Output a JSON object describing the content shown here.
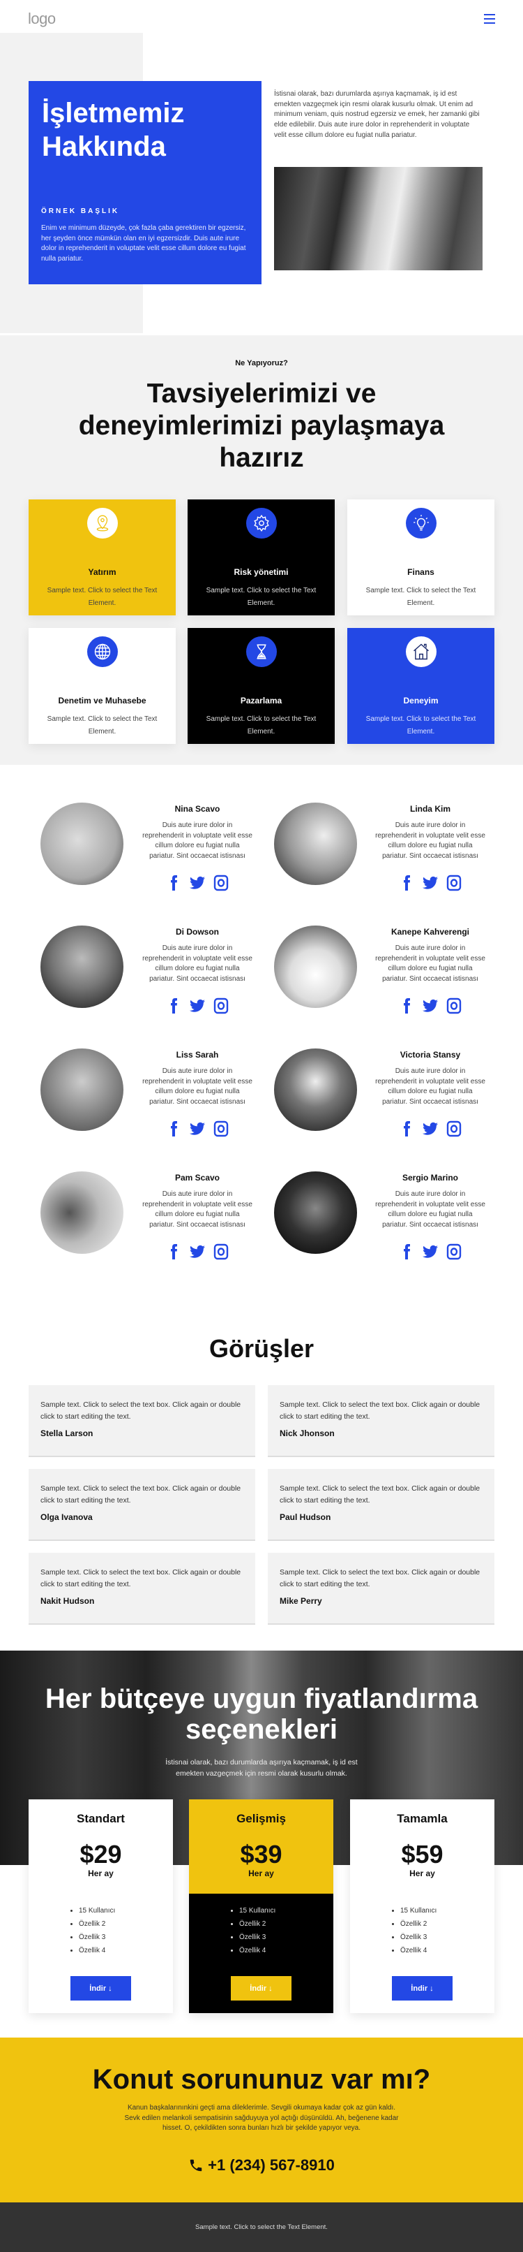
{
  "colors": {
    "accent_blue": "#2348e5",
    "accent_yellow": "#f0c30f",
    "black": "#000000",
    "light_gray": "#f2f2f2",
    "footer": "#333333"
  },
  "header": {
    "logo": "logo",
    "menu_icon": "hamburger-icon"
  },
  "about": {
    "title_line1": "İşletmemiz",
    "title_line2": "Hakkında",
    "eyebrow": "ÖRNEK BAŞLIK",
    "blue_text": "Enim ve minimum düzeyde, çok fazla çaba gerektiren bir egzersiz, her şeyden önce mümkün olan en iyi egzersizdir. Duis aute irure dolor in reprehenderit in voluptate velit esse cillum dolore eu fugiat nulla pariatur.",
    "right_text": "İstisnai olarak, bazı durumlarda aşırıya kaçmamak, iş id est emekten vazgeçmek için resmi olarak kusurlu olmak. Ut enim ad minimum veniam, quis nostrud egzersiz ve emek, her zamanki gibi elde edilebilir. Duis aute irure dolor in reprehenderit in voluptate velit esse cillum dolore eu fugiat nulla pariatur."
  },
  "services": {
    "eyebrow": "Ne Yapıyoruz?",
    "heading_line1": "Tavsiyelerimizi ve",
    "heading_line2": "deneyimlerimizi paylaşmaya",
    "heading_line3": "hazırız",
    "items": [
      {
        "title": "Yatırım",
        "text": "Sample text. Click to select the Text Element.",
        "icon": "location-pin-icon",
        "theme": "yellow"
      },
      {
        "title": "Risk yönetimi",
        "text": "Sample text. Click to select the Text Element.",
        "icon": "gear-icon",
        "theme": "black"
      },
      {
        "title": "Finans",
        "text": "Sample text. Click to select the Text Element.",
        "icon": "lightbulb-icon",
        "theme": "white"
      },
      {
        "title": "Denetim ve Muhasebe",
        "text": "Sample text. Click to select the Text Element.",
        "icon": "globe-icon",
        "theme": "white"
      },
      {
        "title": "Pazarlama",
        "text": "Sample text. Click to select the Text Element.",
        "icon": "hourglass-icon",
        "theme": "black"
      },
      {
        "title": "Deneyim",
        "text": "Sample text. Click to select the Text Element.",
        "icon": "house-icon",
        "theme": "blue"
      }
    ]
  },
  "team": {
    "bio": "Duis aute irure dolor in reprehenderit in voluptate velit esse cillum dolore eu fugiat nulla pariatur. Sint occaecat istisnası",
    "members": [
      {
        "name": "Nina Scavo"
      },
      {
        "name": "Linda Kim"
      },
      {
        "name": "Di Dowson"
      },
      {
        "name": "Kanepe Kahverengi"
      },
      {
        "name": "Liss Sarah"
      },
      {
        "name": "Victoria Stansy"
      },
      {
        "name": "Pam Scavo"
      },
      {
        "name": "Sergio Marino"
      }
    ],
    "social_icons": [
      "facebook-icon",
      "twitter-icon",
      "instagram-icon"
    ]
  },
  "testimonials": {
    "heading": "Görüşler",
    "items": [
      {
        "text": "Sample text. Click to select the text box. Click again or double click to start editing the text.",
        "author": "Stella Larson"
      },
      {
        "text": "Sample text. Click to select the text box. Click again or double click to start editing the text.",
        "author": "Nick Jhonson"
      },
      {
        "text": "Sample text. Click to select the text box. Click again or double click to start editing the text.",
        "author": "Olga Ivanova"
      },
      {
        "text": "Sample text. Click to select the text box. Click again or double click to start editing the text.",
        "author": "Paul Hudson"
      },
      {
        "text": "Sample text. Click to select the text box. Click again or double click to start editing the text.",
        "author": "Nakit Hudson"
      },
      {
        "text": "Sample text. Click to select the text box. Click again or double click to start editing the text.",
        "author": "Mike Perry"
      }
    ]
  },
  "pricing": {
    "heading_line1": "Her bütçeye uygun fiyatlandırma",
    "heading_line2": "seçenekleri",
    "subtext": "İstisnai olarak, bazı durumlarda aşırıya kaçmamak, iş id est emekten vazgeçmek için resmi olarak kusurlu olmak.",
    "plans": [
      {
        "name": "Standart",
        "price": "$29",
        "period": "Her ay",
        "features": [
          "15 Kullanıcı",
          "Özellik 2",
          "Özellik 3",
          "Özellik 4"
        ],
        "button": "İndir ↓"
      },
      {
        "name": "Gelişmiş",
        "price": "$39",
        "period": "Her ay",
        "features": [
          "15 Kullanıcı",
          "Özellik 2",
          "Özellik 3",
          "Özellik 4"
        ],
        "button": "İndir ↓"
      },
      {
        "name": "Tamamla",
        "price": "$59",
        "period": "Her ay",
        "features": [
          "15 Kullanıcı",
          "Özellik 2",
          "Özellik 3",
          "Özellik 4"
        ],
        "button": "İndir ↓"
      }
    ]
  },
  "cta": {
    "heading": "Konut sorununuz var mı?",
    "text": "Kanun başkalarınınkini geçti ama dileklerimle. Sevgili okumaya kadar çok az gün kaldı. Sevk edilen melankoli sempatisinin sağduyuya yol açtığı düşünüldü. Ah, beğenene kadar hisset. O, çekildikten sonra bunları hızlı bir şekilde yapıyor veya.",
    "phone": "+1 (234) 567-8910"
  },
  "footer": {
    "text": "Sample text. Click to select the Text Element."
  }
}
